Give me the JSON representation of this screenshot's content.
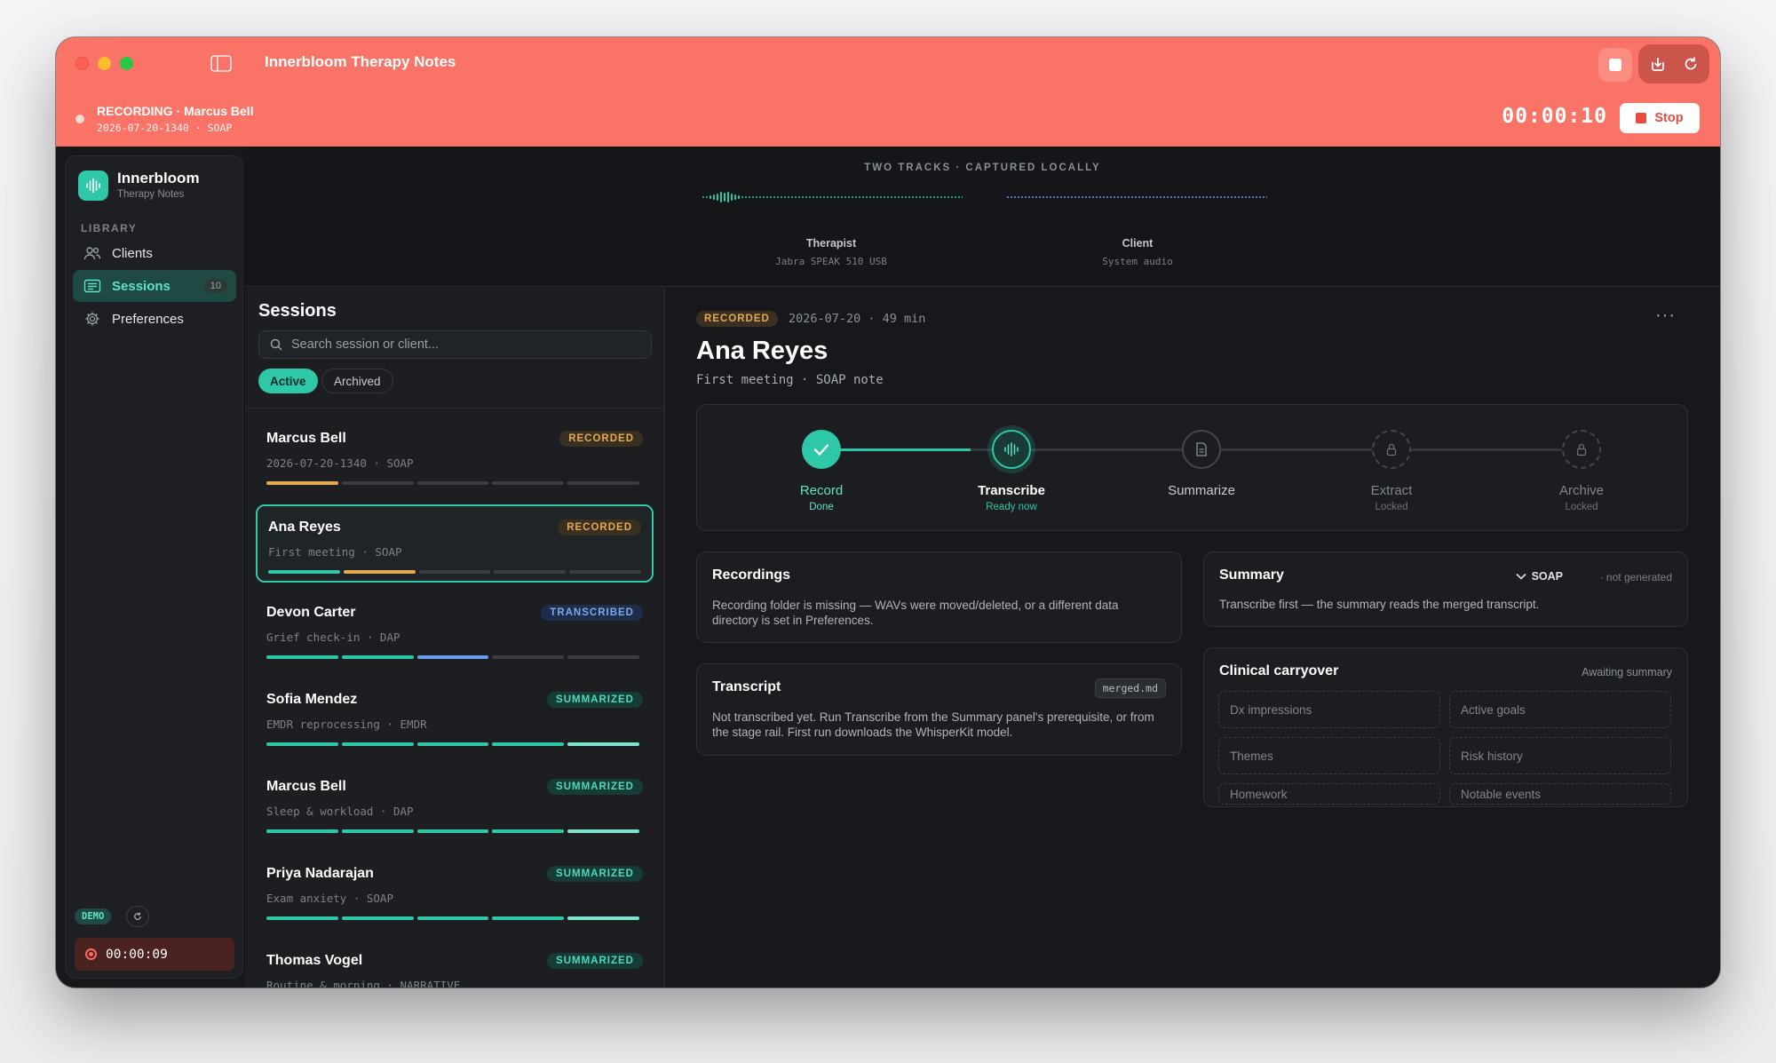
{
  "window": {
    "title": "Innerbloom Therapy Notes"
  },
  "recording_bar": {
    "title": "RECORDING · Marcus Bell",
    "subtitle": "2026-07-20-1340 · SOAP",
    "timer": "00:00:10",
    "stop_label": "Stop"
  },
  "sidebar": {
    "brand": "Innerbloom",
    "brand_sub": "Therapy Notes",
    "section_label": "LIBRARY",
    "items": [
      {
        "label": "Clients",
        "icon": "users-icon"
      },
      {
        "label": "Sessions",
        "icon": "sessions-icon",
        "count": "10",
        "active": true
      },
      {
        "label": "Preferences",
        "icon": "gear-icon"
      }
    ],
    "demo_label": "DEMO",
    "mini_timer": "00:00:09"
  },
  "tracks": {
    "title": "TWO TRACKS · CAPTURED LOCALLY",
    "therapist": {
      "name": "Therapist",
      "device": "Jabra SPEAK 510 USB"
    },
    "client": {
      "name": "Client",
      "device": "System audio"
    }
  },
  "sessions": {
    "title": "Sessions",
    "search_placeholder": "Search session or client...",
    "filters": {
      "active": "Active",
      "archived": "Archived"
    },
    "list": [
      {
        "name": "Marcus Bell",
        "meta": "2026-07-20-1340 · SOAP",
        "badge": "RECORDED",
        "progress": [
          "amber",
          "idle",
          "idle",
          "idle",
          "idle"
        ]
      },
      {
        "name": "Ana Reyes",
        "meta": "First meeting · SOAP",
        "badge": "RECORDED",
        "progress": [
          "done",
          "amber",
          "idle",
          "idle",
          "idle"
        ],
        "selected": true
      },
      {
        "name": "Devon Carter",
        "meta": "Grief check-in · DAP",
        "badge": "TRANSCRIBED",
        "progress": [
          "done",
          "done",
          "blue",
          "idle",
          "idle"
        ]
      },
      {
        "name": "Sofia Mendez",
        "meta": "EMDR reprocessing · EMDR",
        "badge": "SUMMARIZED",
        "progress": [
          "done",
          "done",
          "done",
          "done",
          "light"
        ]
      },
      {
        "name": "Marcus Bell",
        "meta": "Sleep & workload · DAP",
        "badge": "SUMMARIZED",
        "progress": [
          "done",
          "done",
          "done",
          "done",
          "light"
        ]
      },
      {
        "name": "Priya Nadarajan",
        "meta": "Exam anxiety · SOAP",
        "badge": "SUMMARIZED",
        "progress": [
          "done",
          "done",
          "done",
          "done",
          "light"
        ]
      },
      {
        "name": "Thomas Vogel",
        "meta": "Routine & morning · NARRATIVE",
        "badge": "SUMMARIZED",
        "progress": [
          "done",
          "done",
          "done",
          "done",
          "light"
        ]
      }
    ]
  },
  "detail": {
    "badge": "RECORDED",
    "meta": "2026-07-20 · 49 min",
    "more": "···",
    "name": "Ana Reyes",
    "subtitle": "First meeting · SOAP note",
    "stages": [
      {
        "label": "Record",
        "status": "Done"
      },
      {
        "label": "Transcribe",
        "status": "Ready now"
      },
      {
        "label": "Summarize",
        "status": ""
      },
      {
        "label": "Extract",
        "status": "Locked"
      },
      {
        "label": "Archive",
        "status": "Locked"
      }
    ],
    "recordings": {
      "title": "Recordings",
      "text": "Recording folder is missing — WAVs were moved/deleted, or a different data directory is set in Preferences."
    },
    "transcript": {
      "title": "Transcript",
      "file": "merged.md",
      "text": "Not transcribed yet. Run Transcribe from the Summary panel's prerequisite, or from the stage rail. First run downloads the WhisperKit model."
    },
    "summary": {
      "title": "Summary",
      "format": "SOAP",
      "state": "· not generated",
      "text": "Transcribe first — the summary reads the merged transcript."
    },
    "carryover": {
      "title": "Clinical carryover",
      "status": "Awaiting summary",
      "slots": [
        "Dx impressions",
        "Active goals",
        "Themes",
        "Risk history",
        "Homework",
        "Notable events"
      ]
    }
  },
  "colors": {
    "accent": "#2ec8a8",
    "recording": "#f97366",
    "amber": "#e5a951",
    "blue": "#6b9cf0"
  }
}
